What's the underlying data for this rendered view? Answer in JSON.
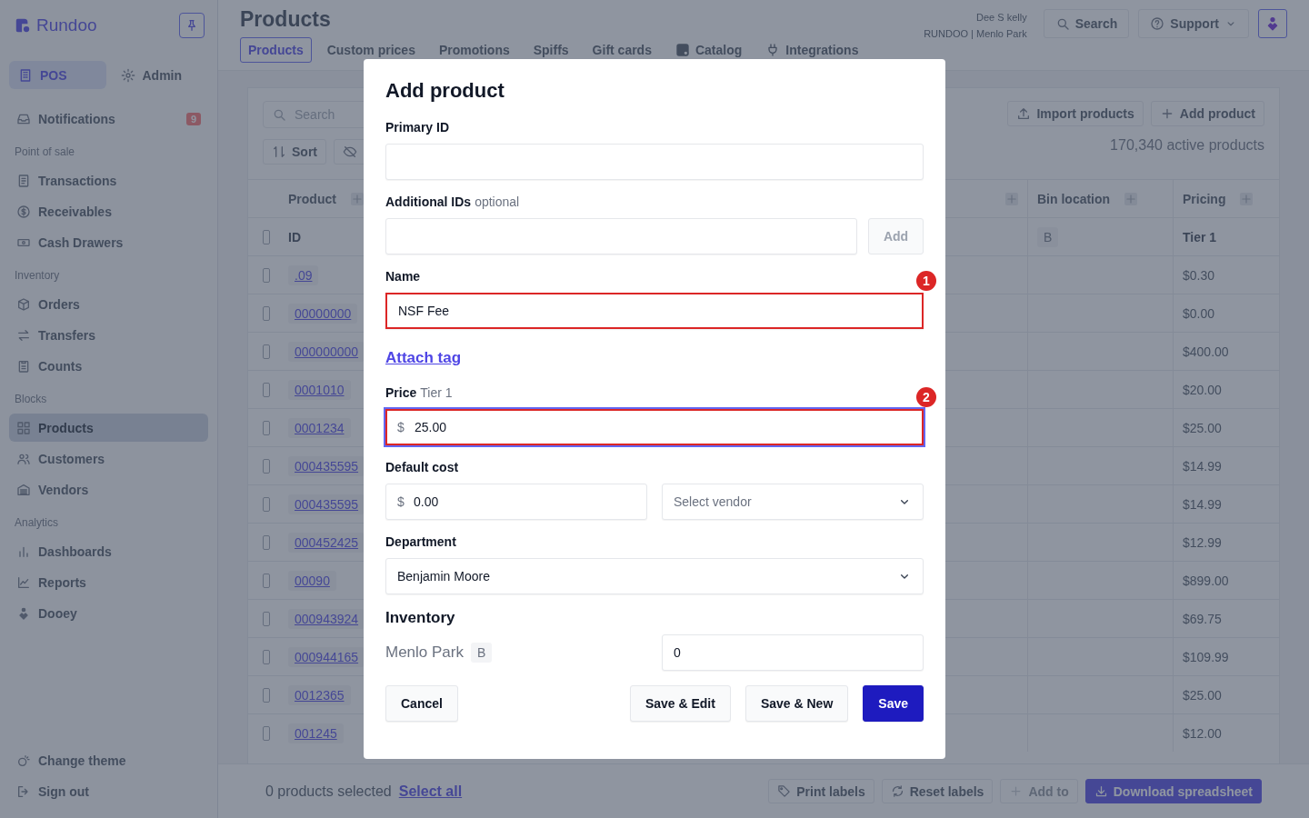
{
  "sidebar": {
    "logo": "Rundoo",
    "modes": [
      {
        "label": "POS",
        "selected": true
      },
      {
        "label": "Admin",
        "selected": false
      }
    ],
    "notifications": {
      "label": "Notifications",
      "count": "9"
    },
    "sections": [
      {
        "heading": "Point of sale",
        "items": [
          {
            "label": "Transactions",
            "selected": false
          },
          {
            "label": "Receivables",
            "selected": false
          },
          {
            "label": "Cash Drawers",
            "selected": false
          }
        ]
      },
      {
        "heading": "Inventory",
        "items": [
          {
            "label": "Orders",
            "selected": false
          },
          {
            "label": "Transfers",
            "selected": false
          },
          {
            "label": "Counts",
            "selected": false
          }
        ]
      },
      {
        "heading": "Blocks",
        "items": [
          {
            "label": "Products",
            "selected": true
          },
          {
            "label": "Customers",
            "selected": false
          },
          {
            "label": "Vendors",
            "selected": false
          }
        ]
      },
      {
        "heading": "Analytics",
        "items": [
          {
            "label": "Dashboards",
            "selected": false
          },
          {
            "label": "Reports",
            "selected": false
          },
          {
            "label": "Dooey",
            "selected": false
          }
        ]
      }
    ],
    "footer_items": [
      "Change theme",
      "Sign out"
    ]
  },
  "header": {
    "title": "Products",
    "tabs": [
      {
        "label": "Products",
        "selected": true
      },
      {
        "label": "Custom prices",
        "selected": false
      },
      {
        "label": "Promotions",
        "selected": false
      },
      {
        "label": "Spiffs",
        "selected": false
      },
      {
        "label": "Gift cards",
        "selected": false
      },
      {
        "label": "Catalog",
        "selected": false
      },
      {
        "label": "Integrations",
        "selected": false
      }
    ],
    "user": {
      "name": "Dee S kelly",
      "org": "RUNDOO | Menlo Park"
    },
    "search_button": "Search",
    "support_button": "Support"
  },
  "toolbar": {
    "search": {
      "placeholder": "Search"
    },
    "sort_button": "Sort",
    "import_button": "Import products",
    "add_button": "Add product",
    "count": "170,340 active products"
  },
  "table": {
    "columns": [
      "Product",
      "Bin location",
      "Pricing"
    ],
    "subheader": {
      "all_checked": false,
      "id": "ID",
      "bin": "B",
      "pricing": "Tier 1"
    },
    "rows": [
      {
        "id": ".09",
        "checked": false,
        "price": "$0.30"
      },
      {
        "id": "00000000",
        "checked": false,
        "price": "$0.00"
      },
      {
        "id": "000000000",
        "checked": false,
        "price": "$400.00"
      },
      {
        "id": "0001010",
        "checked": false,
        "price": "$20.00"
      },
      {
        "id": "0001234",
        "checked": false,
        "price": "$25.00"
      },
      {
        "id": "000435595",
        "checked": false,
        "price": "$14.99"
      },
      {
        "id": "000435595",
        "checked": false,
        "price": "$14.99"
      },
      {
        "id": "000452425",
        "checked": false,
        "price": "$12.99"
      },
      {
        "id": "00090",
        "checked": false,
        "price": "$899.00"
      },
      {
        "id": "000943924",
        "checked": false,
        "price": "$69.75"
      },
      {
        "id": "000944165",
        "checked": false,
        "price": "$109.99"
      },
      {
        "id": "0012365",
        "checked": false,
        "price": "$25.00"
      },
      {
        "id": "001245",
        "checked": false,
        "price": "$12.00"
      }
    ]
  },
  "footer": {
    "selected_text": "0 products selected",
    "select_all": "Select all",
    "actions": [
      {
        "label": "Print labels",
        "kind": "default",
        "disabled": false
      },
      {
        "label": "Reset labels",
        "kind": "default",
        "disabled": false
      },
      {
        "label": "Add to",
        "kind": "default",
        "disabled": true
      },
      {
        "label": "Download spreadsheet",
        "kind": "primary",
        "disabled": false
      }
    ]
  },
  "dialog": {
    "title": "Add product",
    "primary_id": {
      "label": "Primary ID"
    },
    "additional_ids": {
      "label": "Additional IDs",
      "hint": "optional",
      "add_button": "Add"
    },
    "name": {
      "label": "Name",
      "value": "NSF Fee",
      "marker": "1",
      "focused": false
    },
    "attach_tag": "Attach tag",
    "price": {
      "label": "Price",
      "hint": "Tier 1",
      "currency": "$",
      "value": "25.00",
      "marker": "2",
      "focused": true
    },
    "default_cost": {
      "label": "Default cost",
      "currency": "$",
      "value": "0.00",
      "vendor_placeholder": "Select vendor"
    },
    "department": {
      "label": "Department",
      "value": "Benjamin Moore"
    },
    "inventory": {
      "heading": "Inventory",
      "location": "Menlo Park",
      "bin": "B",
      "quantity": "0"
    },
    "buttons": [
      {
        "label": "Cancel",
        "kind": "default"
      },
      {
        "label": "Save & Edit",
        "kind": "default"
      },
      {
        "label": "Save & New",
        "kind": "default"
      },
      {
        "label": "Save",
        "kind": "primary"
      }
    ]
  }
}
